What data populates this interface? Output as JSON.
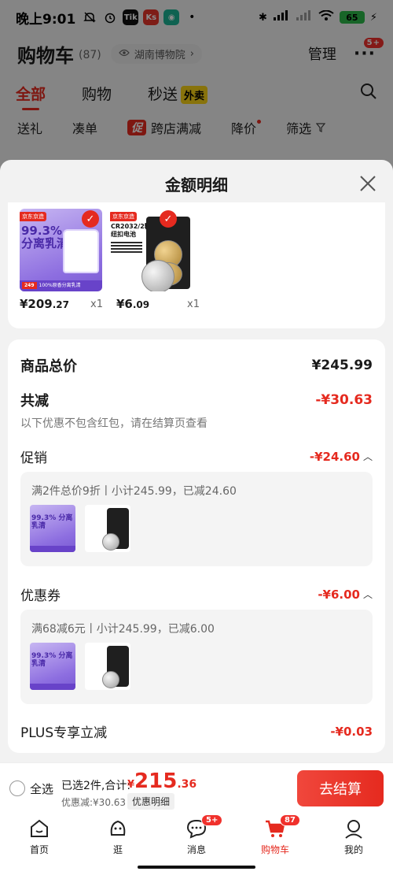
{
  "status_bar": {
    "time": "晚上9:01",
    "app_icon_1": "Tik",
    "app_icon_2": "Ks",
    "battery": "65"
  },
  "header": {
    "title": "购物车",
    "count": "(87)",
    "location": "湖南博物院",
    "manage": "管理",
    "more_badge": "5+"
  },
  "tabs": [
    {
      "label": "全部"
    },
    {
      "label": "购物"
    },
    {
      "label": "秒送",
      "tag": "外卖"
    }
  ],
  "chips": [
    "送礼",
    "凑单",
    "跨店满减",
    "降价",
    "筛选"
  ],
  "chip_tag": "促",
  "sheet": {
    "title": "金额明细",
    "products": [
      {
        "price_int": "¥209",
        "price_dec": ".27",
        "qty": "x1"
      },
      {
        "price_int": "¥6",
        "price_dec": ".09",
        "qty": "x1"
      }
    ],
    "total_label": "商品总价",
    "total_value": "¥245.99",
    "discount_label": "共减",
    "discount_value": "-¥30.63",
    "note": "以下优惠不包含红包，请在结算页查看",
    "promo_label": "促销",
    "promo_value": "-¥24.60",
    "promo_desc": "满2件总价9折丨小计245.99，已减24.60",
    "coupon_label": "优惠券",
    "coupon_value": "-¥6.00",
    "coupon_desc": "满68减6元丨小计245.99，已减6.00",
    "plus_label": "PLUS专享立减",
    "plus_value": "-¥0.03"
  },
  "product_art": {
    "jd_label": "京东京造",
    "milk_title": "99.3%\n分离乳清",
    "milk_strip_tag": "249",
    "milk_strip": "100%原香分离乳清",
    "battery_title": "CR2032/2粒\n纽扣电池"
  },
  "checkout": {
    "select_all": "全选",
    "selected": "已选2件,合计:",
    "currency": "¥",
    "total_int": "215",
    "total_dec": ".36",
    "saved": "优惠减:¥30.63",
    "detail": "优惠明细",
    "button": "去结算"
  },
  "nav": [
    {
      "label": "首页",
      "icon": "home-icon"
    },
    {
      "label": "逛",
      "icon": "explore-icon"
    },
    {
      "label": "消息",
      "icon": "message-icon",
      "badge": "5+"
    },
    {
      "label": "购物车",
      "icon": "cart-icon",
      "badge": "87"
    },
    {
      "label": "我的",
      "icon": "profile-icon"
    }
  ],
  "colors": {
    "accent": "#e52a1f",
    "waimai_tag": "#f7d117",
    "battery_green": "#2db84a"
  }
}
